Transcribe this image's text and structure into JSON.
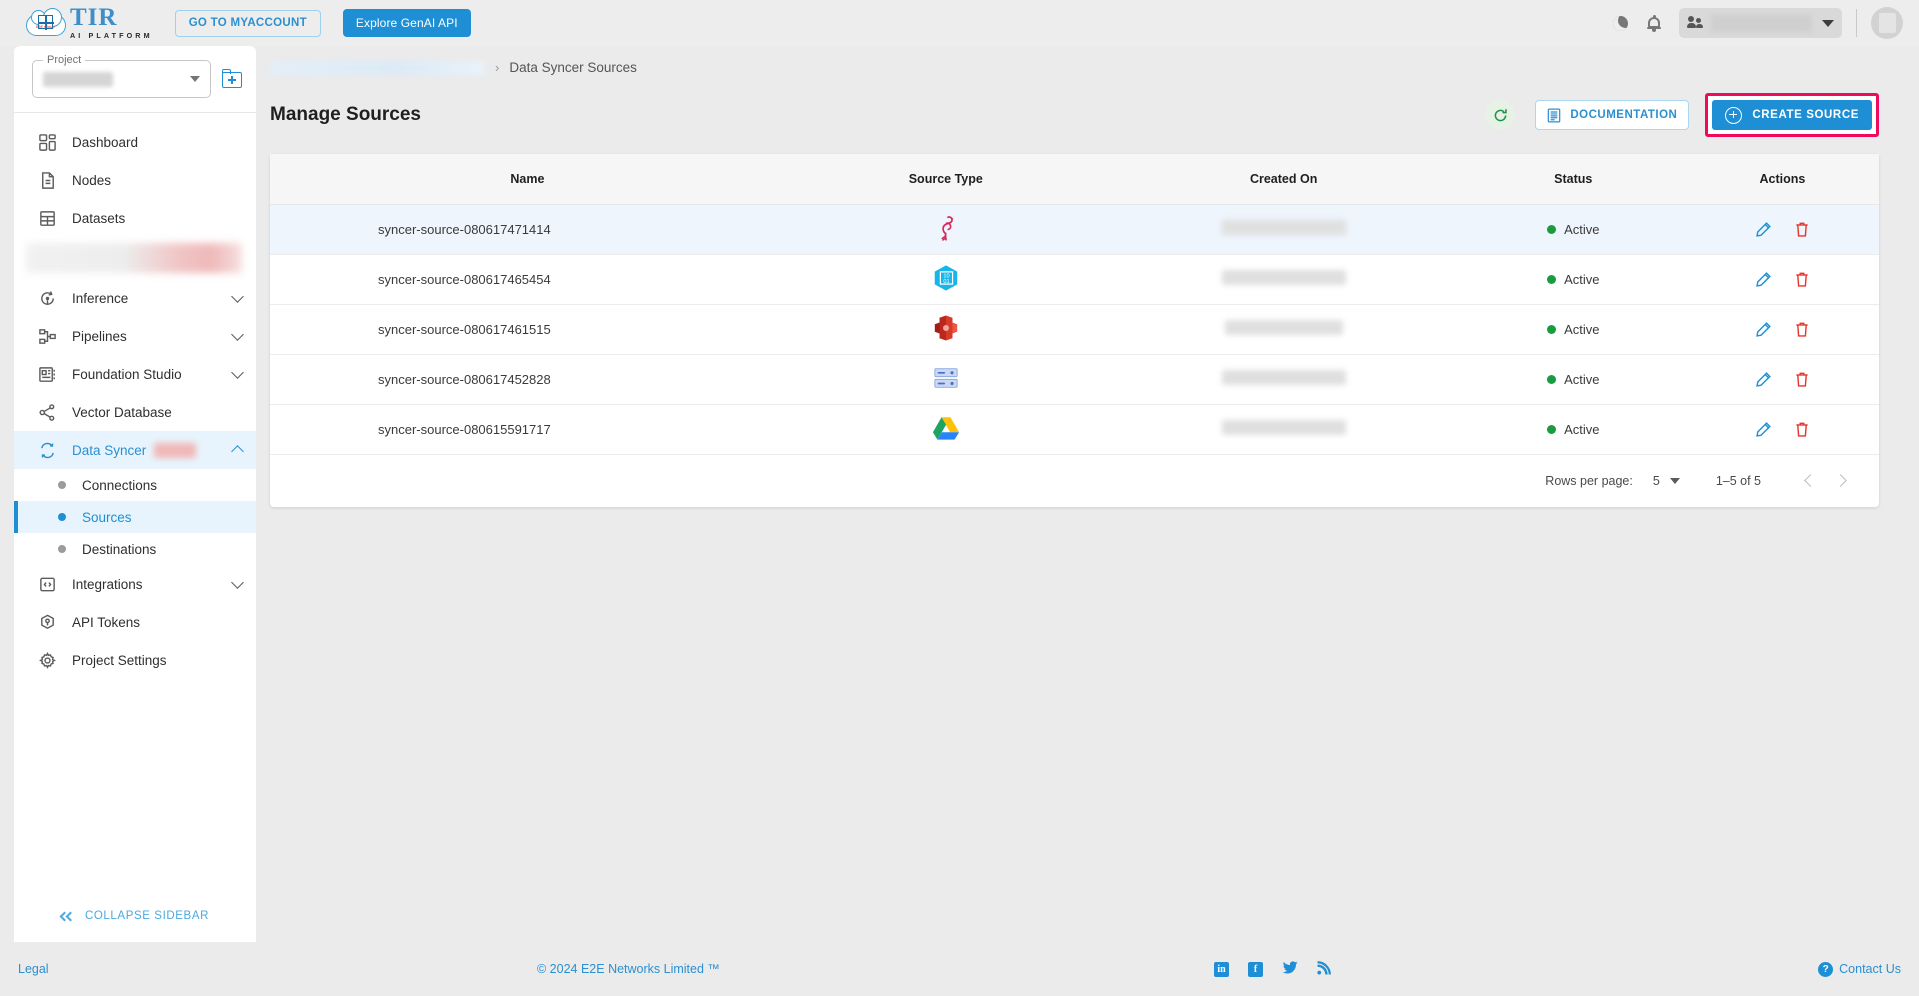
{
  "topbar": {
    "logo_title": "TIR",
    "logo_subtitle": "AI PLATFORM",
    "logo_cloud_label": "E2E Cloud",
    "myaccount_label": "GO TO MYACCOUNT",
    "genai_label": "Explore GenAI API",
    "dark_mode_icon": "moon-icon",
    "notifications_icon": "bell-icon",
    "team_selector_value": "",
    "avatar_icon": "user-avatar"
  },
  "sidebar": {
    "project_label": "Project",
    "project_value": "",
    "new_project_icon": "folder-add-icon",
    "items": [
      {
        "label": "Dashboard",
        "icon": "dashboard-icon",
        "expandable": false
      },
      {
        "label": "Nodes",
        "icon": "document-icon",
        "expandable": false
      },
      {
        "label": "Datasets",
        "icon": "grid-table-icon",
        "expandable": false
      },
      {
        "label": "",
        "icon": "redacted",
        "expandable": false,
        "redacted": true
      },
      {
        "label": "Inference",
        "icon": "inference-icon",
        "expandable": true
      },
      {
        "label": "Pipelines",
        "icon": "pipelines-icon",
        "expandable": true
      },
      {
        "label": "Foundation Studio",
        "icon": "foundation-studio-icon",
        "expandable": true
      },
      {
        "label": "Vector Database",
        "icon": "share-nodes-icon",
        "expandable": false
      },
      {
        "label": "Data Syncer",
        "icon": "sync-icon",
        "expandable": true,
        "open": true,
        "badge": ""
      },
      {
        "label": "Integrations",
        "icon": "code-brackets-icon",
        "expandable": true
      },
      {
        "label": "API Tokens",
        "icon": "token-cube-icon",
        "expandable": false
      },
      {
        "label": "Project Settings",
        "icon": "gear-icon",
        "expandable": false
      }
    ],
    "data_syncer_children": [
      {
        "label": "Connections",
        "active": false
      },
      {
        "label": "Sources",
        "active": true
      },
      {
        "label": "Destinations",
        "active": false
      }
    ],
    "collapse_label": "COLLAPSE SIDEBAR"
  },
  "breadcrumb": {
    "parent": "",
    "separator": "›",
    "current": "Data Syncer Sources"
  },
  "page": {
    "title": "Manage Sources",
    "refresh_icon": "refresh-icon",
    "documentation_label": "DOCUMENTATION",
    "create_source_label": "CREATE SOURCE",
    "highlight_color": "#ef0a5e",
    "accent_color": "#1e8fd5"
  },
  "table": {
    "columns": [
      "Name",
      "Source Type",
      "Created On",
      "Status",
      "Actions"
    ],
    "rows": [
      {
        "name": "syncer-source-080617471414",
        "source_type_icon": "flamingo-icon",
        "created_on": "",
        "status": "Active",
        "highlighted": true
      },
      {
        "name": "syncer-source-080617465454",
        "source_type_icon": "azure-data-lake-icon",
        "created_on": "",
        "status": "Active",
        "highlighted": false
      },
      {
        "name": "syncer-source-080617461515",
        "source_type_icon": "amazon-redshift-icon",
        "created_on": "",
        "status": "Active",
        "highlighted": false
      },
      {
        "name": "syncer-source-080617452828",
        "source_type_icon": "database-servers-icon",
        "created_on": "",
        "status": "Active",
        "highlighted": false
      },
      {
        "name": "syncer-source-080615591717",
        "source_type_icon": "google-drive-icon",
        "created_on": "",
        "status": "Active",
        "highlighted": false
      }
    ],
    "row_action_icons": [
      "edit-pencil-icon",
      "delete-trash-icon"
    ],
    "status_color": "#1a9c3e"
  },
  "pagination": {
    "rows_per_page_label": "Rows per page:",
    "rows_per_page_value": "5",
    "range_label": "1–5 of 5",
    "prev_icon": "chevron-left-icon",
    "next_icon": "chevron-right-icon"
  },
  "footer": {
    "legal": "Legal",
    "copyright": "© 2024 E2E Networks Limited ™",
    "social": [
      "linkedin-icon",
      "facebook-icon",
      "twitter-icon",
      "rss-icon"
    ],
    "contact": "Contact Us"
  }
}
